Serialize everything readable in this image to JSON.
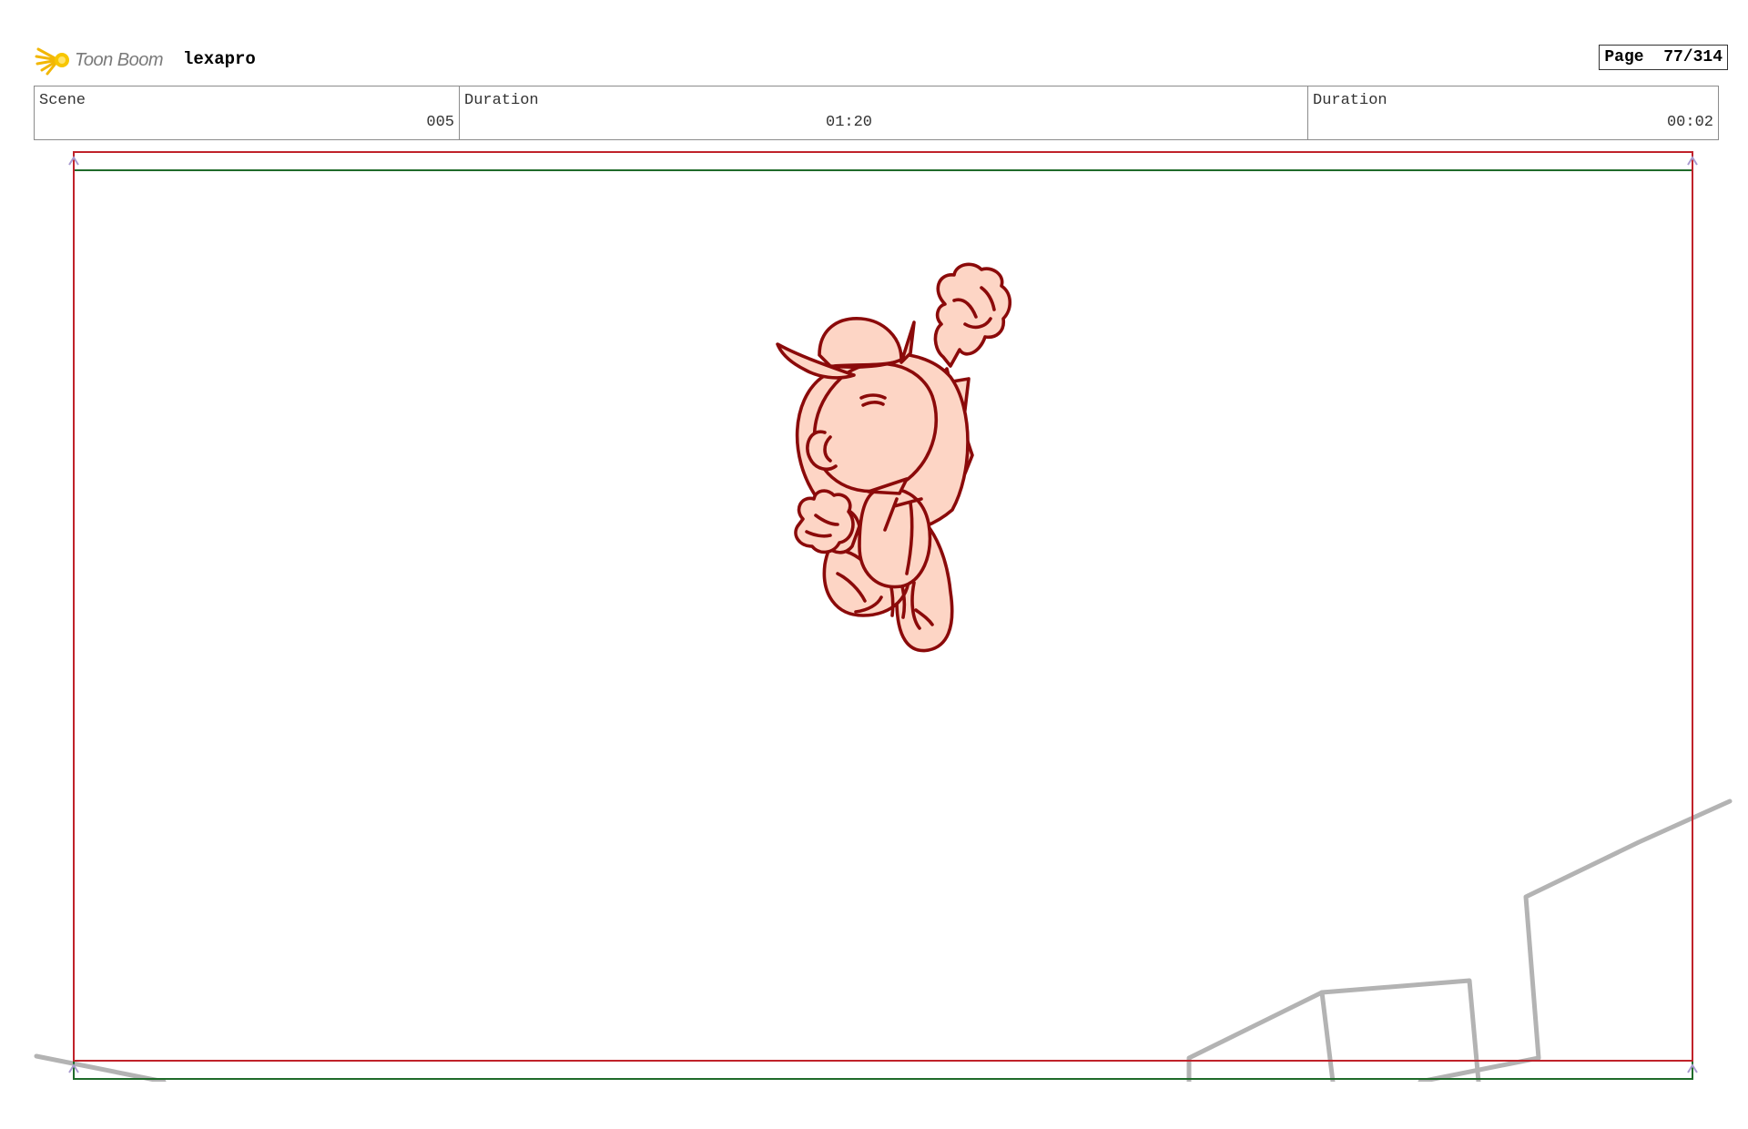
{
  "header": {
    "brand": "Toon Boom",
    "project": "lexapro",
    "page_label": "Page",
    "page_number": "77/314"
  },
  "info": {
    "scene_label": "Scene",
    "scene_value": "005",
    "duration1_label": "Duration",
    "duration1_value": "01:20",
    "duration2_label": "Duration",
    "duration2_value": "00:02"
  },
  "panel": {
    "safe_frame_color": "#c0222a",
    "camera_frame_color": "#1f6b2a",
    "character_stroke": "#8b0a0a",
    "character_fill": "#fdd5c5",
    "background_stroke": "#b3b3b3"
  }
}
